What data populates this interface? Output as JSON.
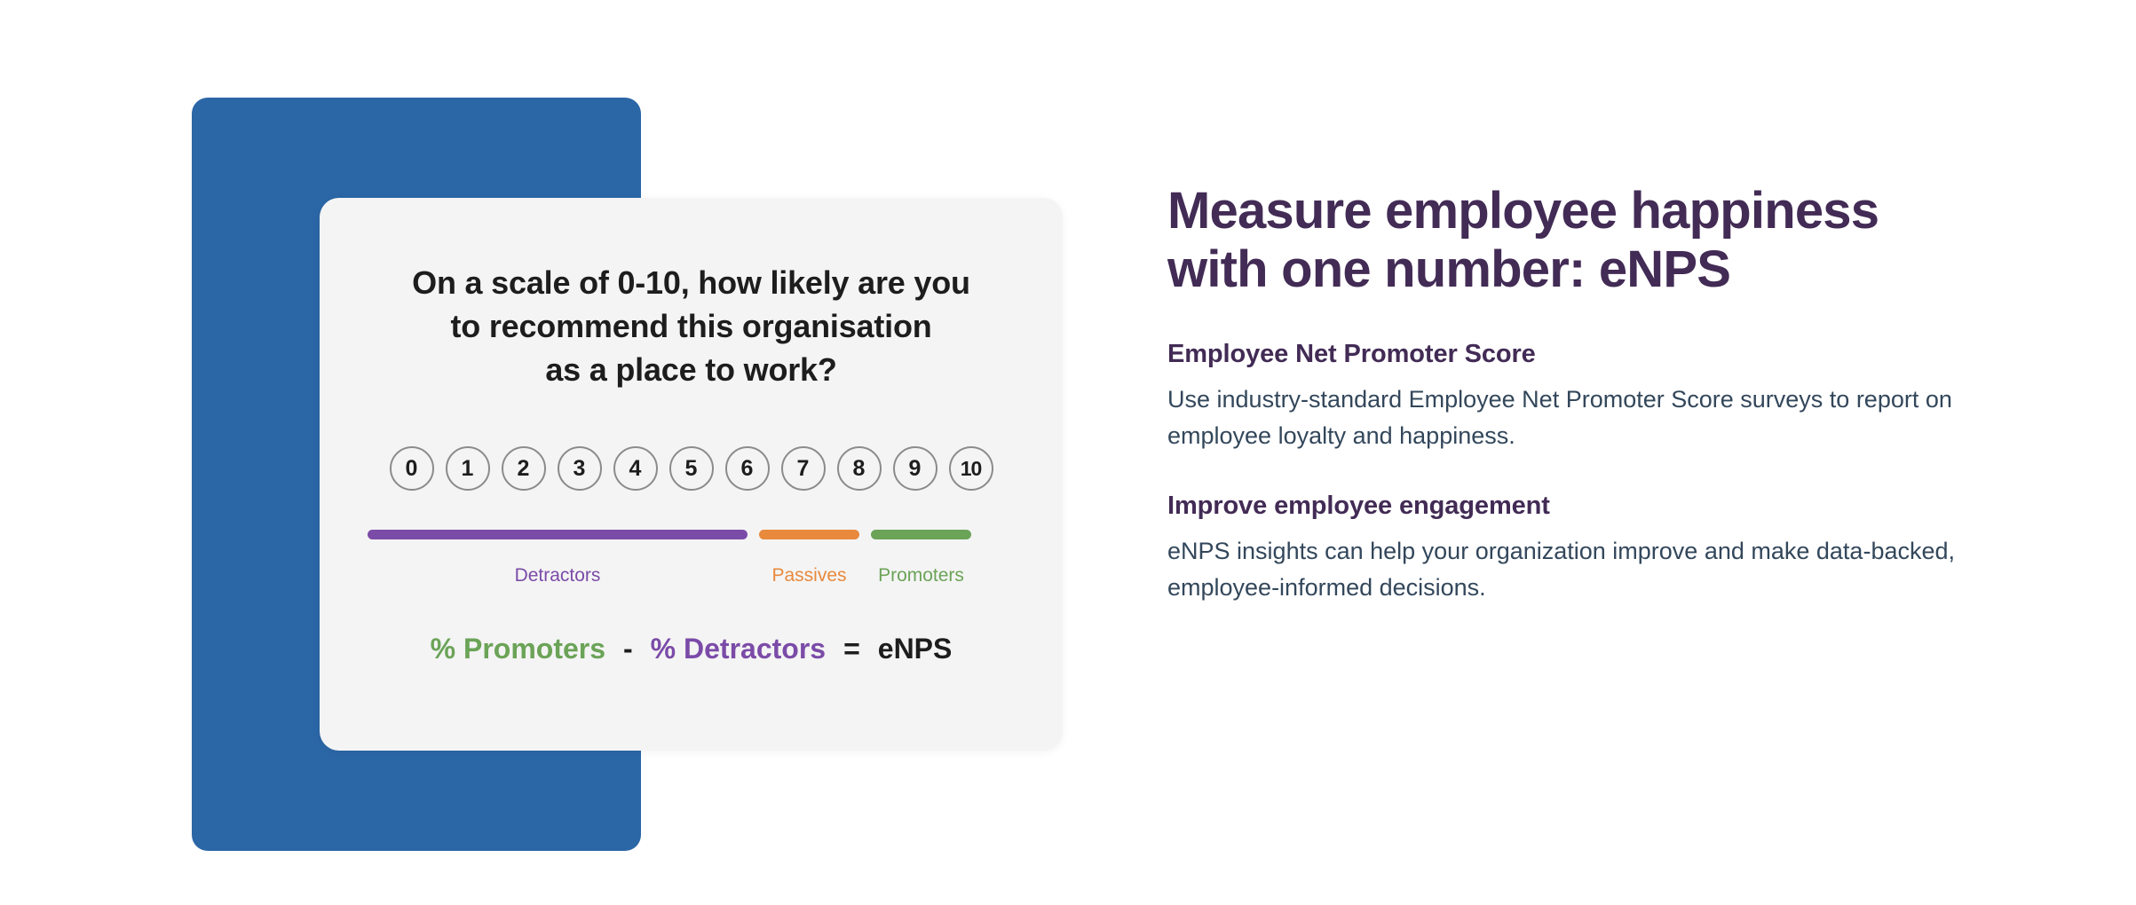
{
  "illustration": {
    "survey_card": {
      "question_lines": [
        "On a scale of 0-10, how likely are you",
        "to recommend this organisation",
        "as a place to work?"
      ],
      "scale_options": [
        "0",
        "1",
        "2",
        "3",
        "4",
        "5",
        "6",
        "7",
        "8",
        "9",
        "10"
      ],
      "segments": [
        {
          "label": "Detractors",
          "color": "#7B4BA8",
          "range": "0-6",
          "span": 7
        },
        {
          "label": "Passives",
          "color": "#E8893C",
          "range": "7-8",
          "span": 2
        },
        {
          "label": "Promoters",
          "color": "#6BA357",
          "range": "9-10",
          "span": 2
        }
      ],
      "formula": {
        "term_one": "% Promoters",
        "term_one_color": "#6BA357",
        "operator_minus": "-",
        "term_two": "% Detractors",
        "term_two_color": "#7B4BA8",
        "operator_equals": "=",
        "result": "eNPS",
        "result_color": "#1D1D1D"
      }
    },
    "colors": {
      "blue_panel": "#2B66A6",
      "card_background": "#F4F4F4",
      "circle_border": "#8B8B8B"
    }
  },
  "content": {
    "heading_lines": [
      "Measure employee happiness",
      "with one number: eNPS"
    ],
    "sections": [
      {
        "title": "Employee Net Promoter Score",
        "body": "Use industry-standard Employee Net Promoter Score surveys to report on employee loyalty and happiness."
      },
      {
        "title": "Improve employee engagement",
        "body": "eNPS insights can help your organization improve and make data-backed, employee-informed decisions."
      }
    ],
    "colors": {
      "heading": "#422B55",
      "body": "#33475B"
    }
  }
}
